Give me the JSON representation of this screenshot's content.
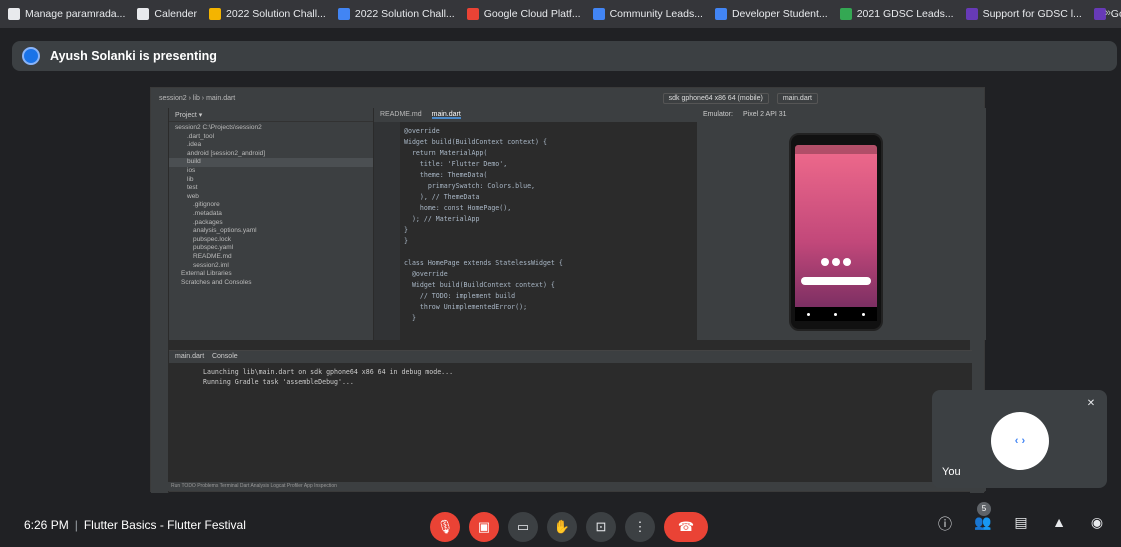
{
  "bookmarks": [
    {
      "label": "Manage paramrada...",
      "color": "#e8eaed",
      "icon": "github-icon"
    },
    {
      "label": "Calender",
      "color": "#e8eaed",
      "icon": "notion-icon"
    },
    {
      "label": "2022 Solution Chall...",
      "color": "#f4b400",
      "icon": "folder-icon"
    },
    {
      "label": "2022 Solution Chall...",
      "color": "#4285f4",
      "icon": "docs-icon"
    },
    {
      "label": "Google Cloud Platf...",
      "color": "#ea4335",
      "icon": "cloud-icon"
    },
    {
      "label": "Community Leads...",
      "color": "#4285f4",
      "icon": "gdg-icon"
    },
    {
      "label": "Developer Student...",
      "color": "#4285f4",
      "icon": "gdsc-icon"
    },
    {
      "label": "2021 GDSC Leads...",
      "color": "#34a853",
      "icon": "globe-icon"
    },
    {
      "label": "Support for GDSC l...",
      "color": "#673ab7",
      "icon": "forms-icon"
    },
    {
      "label": "Google Developer...",
      "color": "#673ab7",
      "icon": "forms-icon"
    }
  ],
  "bookmarks_more": "»",
  "presenter": {
    "text": "Ayush Solanki is presenting"
  },
  "shared_screen": {
    "breadcrumb": "session2 › lib › main.dart",
    "device": "sdk gphone64 x86 64 (mobile)",
    "run_config": "main.dart",
    "project_header": "Project ▾",
    "tree": [
      "session2 C:\\Projects\\session2",
      ".dart_tool",
      ".idea",
      "android [session2_android]",
      "build",
      "ios",
      "lib",
      "test",
      "web",
      ".gitignore",
      ".metadata",
      ".packages",
      "analysis_options.yaml",
      "pubspec.lock",
      "pubspec.yaml",
      "README.md",
      "session2.iml",
      "External Libraries",
      "Scratches and Consoles"
    ],
    "tabs": [
      "README.md",
      "main.dart"
    ],
    "code": [
      "@override",
      "Widget build(BuildContext context) {",
      "  return MaterialApp(",
      "    title: 'Flutter Demo',",
      "    theme: ThemeData(",
      "      primarySwatch: Colors.blue,",
      "    ), // ThemeData",
      "    home: const HomePage(),",
      "  ); // MaterialApp",
      "}",
      "}",
      "",
      "class HomePage extends StatelessWidget {",
      "  @override",
      "  Widget build(BuildContext context) {",
      "    // TODO: implement build",
      "    throw UnimplementedError();",
      "  }"
    ],
    "emulator_header": "Emulator:",
    "emulator_device": "Pixel 2 API 31",
    "run_tab": "main.dart",
    "console_tab": "Console",
    "console": [
      "Launching lib\\main.dart on sdk gphone64 x86 64 in debug mode...",
      "Running Gradle task 'assembleDebug'..."
    ],
    "status_items": "Run   TODO   Problems   Terminal   Dart Analysis   Logcat   Profiler   App Inspection"
  },
  "self_tile": {
    "label": "You"
  },
  "meeting": {
    "time": "6:26 PM",
    "separator": "|",
    "title": "Flutter Basics - Flutter Festival"
  },
  "participants_count": "5",
  "colors": {
    "end_call": "#ea4335",
    "muted": "#ea4335",
    "bar_bg": "#3c4043"
  }
}
